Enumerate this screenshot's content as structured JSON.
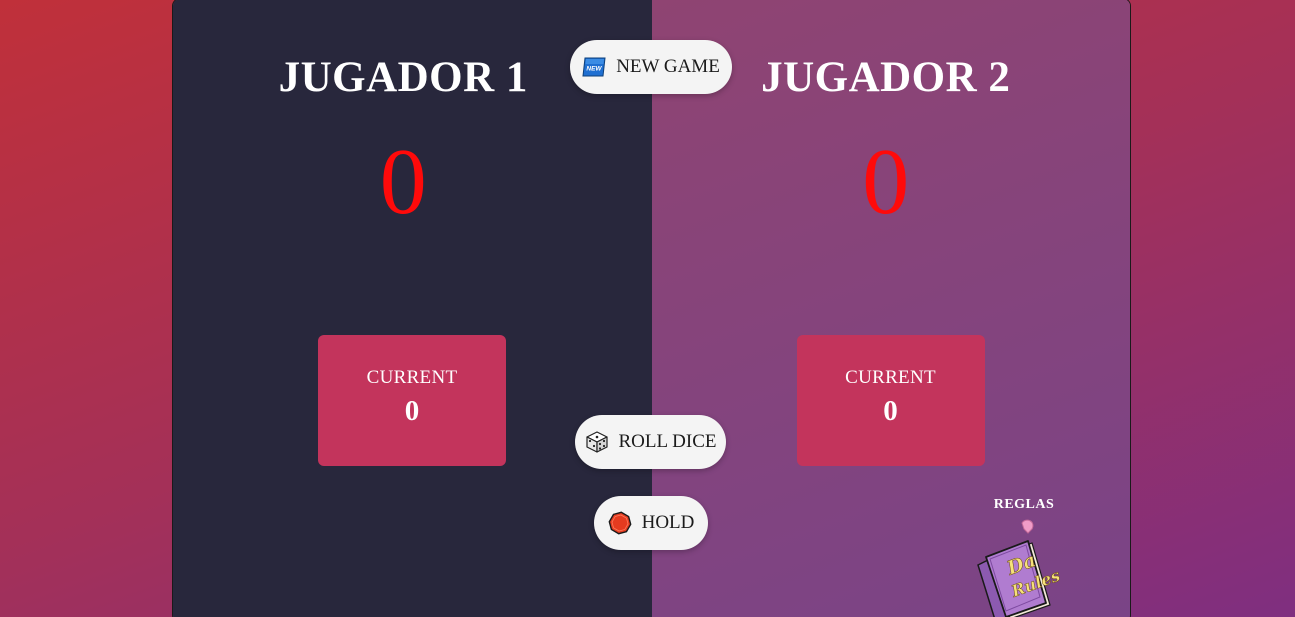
{
  "players": [
    {
      "name": "JUGADOR 1",
      "score": "0",
      "current_label": "CURRENT",
      "current_score": "0"
    },
    {
      "name": "JUGADOR 2",
      "score": "0",
      "current_label": "CURRENT",
      "current_score": "0"
    }
  ],
  "buttons": {
    "new_game": {
      "label": "NEW GAME",
      "icon": "new-badge-icon"
    },
    "roll_dice": {
      "label": "ROLL DICE",
      "icon": "dice-icon"
    },
    "hold": {
      "label": "HOLD",
      "icon": "stop-sign-icon"
    }
  },
  "rules": {
    "label": "REGLAS",
    "book_text_line1": "Da",
    "book_text_line2": "Rules",
    "icon": "rules-book-icon"
  },
  "colors": {
    "player1_bg": "#28273c",
    "player2_bg": "#8a4478",
    "score": "#ff0a0a",
    "current_box": "#c3345c",
    "button_bg": "#f4f4f4"
  }
}
